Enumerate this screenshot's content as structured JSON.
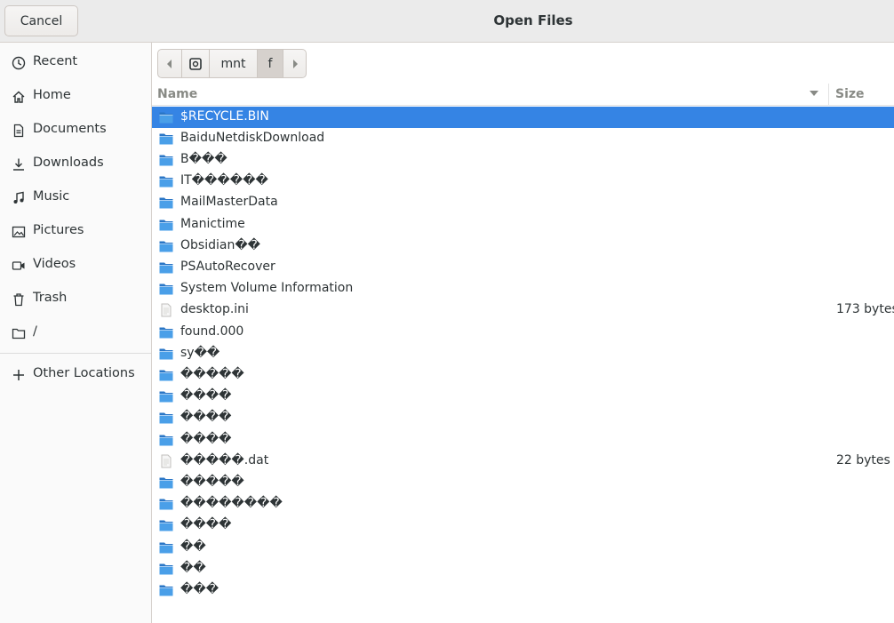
{
  "window": {
    "title": "Open Files",
    "cancel_label": "Cancel"
  },
  "sidebar": {
    "items": [
      {
        "label": "Recent",
        "icon": "clock-icon"
      },
      {
        "label": "Home",
        "icon": "home-icon"
      },
      {
        "label": "Documents",
        "icon": "document-icon"
      },
      {
        "label": "Downloads",
        "icon": "download-icon"
      },
      {
        "label": "Music",
        "icon": "music-icon"
      },
      {
        "label": "Pictures",
        "icon": "picture-icon"
      },
      {
        "label": "Videos",
        "icon": "video-icon"
      },
      {
        "label": "Trash",
        "icon": "trash-icon"
      },
      {
        "label": "/",
        "icon": "folder-icon"
      }
    ],
    "other_locations": "Other Locations"
  },
  "pathbar": {
    "segments": [
      "mnt",
      "f"
    ],
    "active_segment": "f"
  },
  "list_header": {
    "name": "Name",
    "size": "Size"
  },
  "files": [
    {
      "name": "$RECYCLE.BIN",
      "type": "folder",
      "size": "",
      "selected": true
    },
    {
      "name": "BaiduNetdiskDownload",
      "type": "folder",
      "size": ""
    },
    {
      "name": "B���",
      "type": "folder",
      "size": ""
    },
    {
      "name": "IT������",
      "type": "folder",
      "size": ""
    },
    {
      "name": "MailMasterData",
      "type": "folder",
      "size": ""
    },
    {
      "name": "Manictime",
      "type": "folder",
      "size": ""
    },
    {
      "name": "Obsidian��",
      "type": "folder",
      "size": ""
    },
    {
      "name": "PSAutoRecover",
      "type": "folder",
      "size": ""
    },
    {
      "name": "System Volume Information",
      "type": "folder",
      "size": ""
    },
    {
      "name": "desktop.ini",
      "type": "file",
      "size": "173 bytes"
    },
    {
      "name": "found.000",
      "type": "folder",
      "size": ""
    },
    {
      "name": "sy��",
      "type": "folder",
      "size": ""
    },
    {
      "name": "�����",
      "type": "folder",
      "size": ""
    },
    {
      "name": "����",
      "type": "folder",
      "size": ""
    },
    {
      "name": "����",
      "type": "folder",
      "size": ""
    },
    {
      "name": "����",
      "type": "folder",
      "size": ""
    },
    {
      "name": "�����.dat",
      "type": "file",
      "size": "22 bytes"
    },
    {
      "name": "�����",
      "type": "folder",
      "size": ""
    },
    {
      "name": "��������",
      "type": "folder",
      "size": ""
    },
    {
      "name": "����",
      "type": "folder",
      "size": ""
    },
    {
      "name": "��",
      "type": "folder",
      "size": ""
    },
    {
      "name": "��",
      "type": "folder",
      "size": ""
    },
    {
      "name": "���",
      "type": "folder",
      "size": ""
    }
  ],
  "colors": {
    "selection": "#3584e4",
    "folder": "#4a90d9",
    "headerbar": "#ebebeb"
  }
}
